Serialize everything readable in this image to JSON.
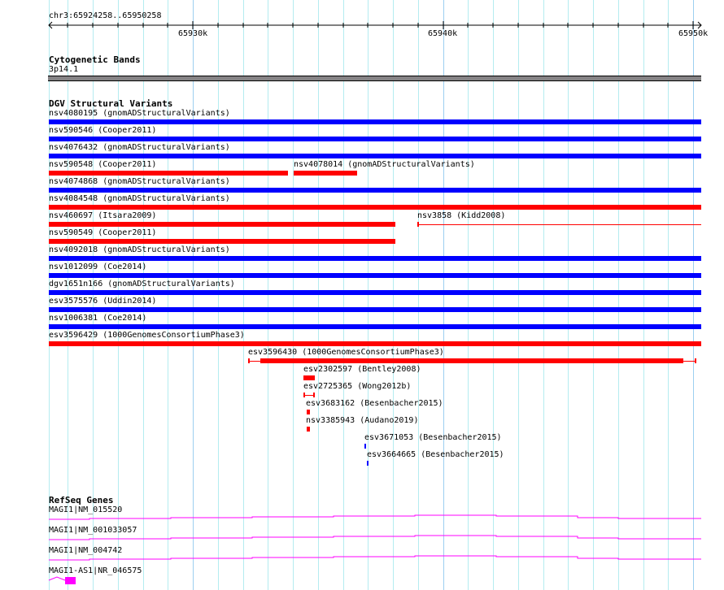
{
  "ruler": {
    "range": "chr3:65924258..65950258",
    "ticks": [
      "65930k",
      "65940k",
      "65950k"
    ]
  },
  "cyto": {
    "title": "Cytogenetic Bands",
    "band": "3p14.1"
  },
  "dgv": {
    "title": "DGV Structural Variants",
    "items": [
      "nsv4080195 (gnomADStructuralVariants)",
      "nsv590546 (Cooper2011)",
      "nsv4076432 (gnomADStructuralVariants)",
      "nsv590548 (Cooper2011)",
      "nsv4078014 (gnomADStructuralVariants)",
      "nsv4074868 (gnomADStructuralVariants)",
      "nsv4084548 (gnomADStructuralVariants)",
      "nsv460697 (Itsara2009)",
      "nsv3858 (Kidd2008)",
      "nsv590549 (Cooper2011)",
      "nsv4092018 (gnomADStructuralVariants)",
      "nsv1012099 (Coe2014)",
      "dgv1651n166 (gnomADStructuralVariants)",
      "esv3575576 (Uddin2014)",
      "nsv1006381 (Coe2014)",
      "esv3596429 (1000GenomesConsortiumPhase3)",
      "esv3596430 (1000GenomesConsortiumPhase3)",
      "esv2302597 (Bentley2008)",
      "esv2725365 (Wong2012b)",
      "esv3683162 (Besenbacher2015)",
      "nsv3385943 (Audano2019)",
      "esv3671053 (Besenbacher2015)",
      "esv3664665 (Besenbacher2015)"
    ]
  },
  "genes": {
    "title": "RefSeq Genes",
    "items": [
      "MAGI1|NM_015520",
      "MAGI1|NM_001033057",
      "MAGI1|NM_004742",
      "MAGI1-AS1|NR_046575"
    ]
  },
  "colors": {
    "gain": "#0000ff",
    "loss": "#ff0000",
    "gene": "#ff00ff"
  }
}
